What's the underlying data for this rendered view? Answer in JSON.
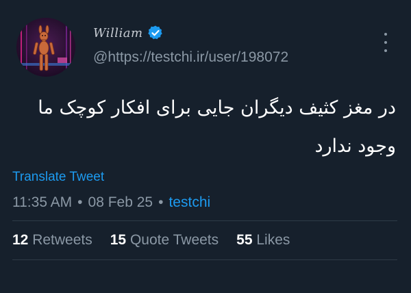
{
  "user": {
    "display_name": "William",
    "handle": "@https://testchi.ir/user/198072",
    "verified_icon": "verified-badge-icon"
  },
  "tweet": {
    "text": "در مغز کثیف دیگران جایی برای افکار کوچک ما وجود ندارد",
    "translate_label": "Translate Tweet",
    "time": "11:35 AM",
    "date": "08 Feb 25",
    "separator": "•",
    "source": "testchi"
  },
  "stats": {
    "retweets_count": "12",
    "retweets_label": "Retweets",
    "quotes_count": "15",
    "quotes_label": "Quote Tweets",
    "likes_count": "55",
    "likes_label": "Likes"
  },
  "colors": {
    "background": "#16202c",
    "accent": "#1d9bf0",
    "muted": "#8b98a5",
    "divider": "#2f3b47"
  }
}
